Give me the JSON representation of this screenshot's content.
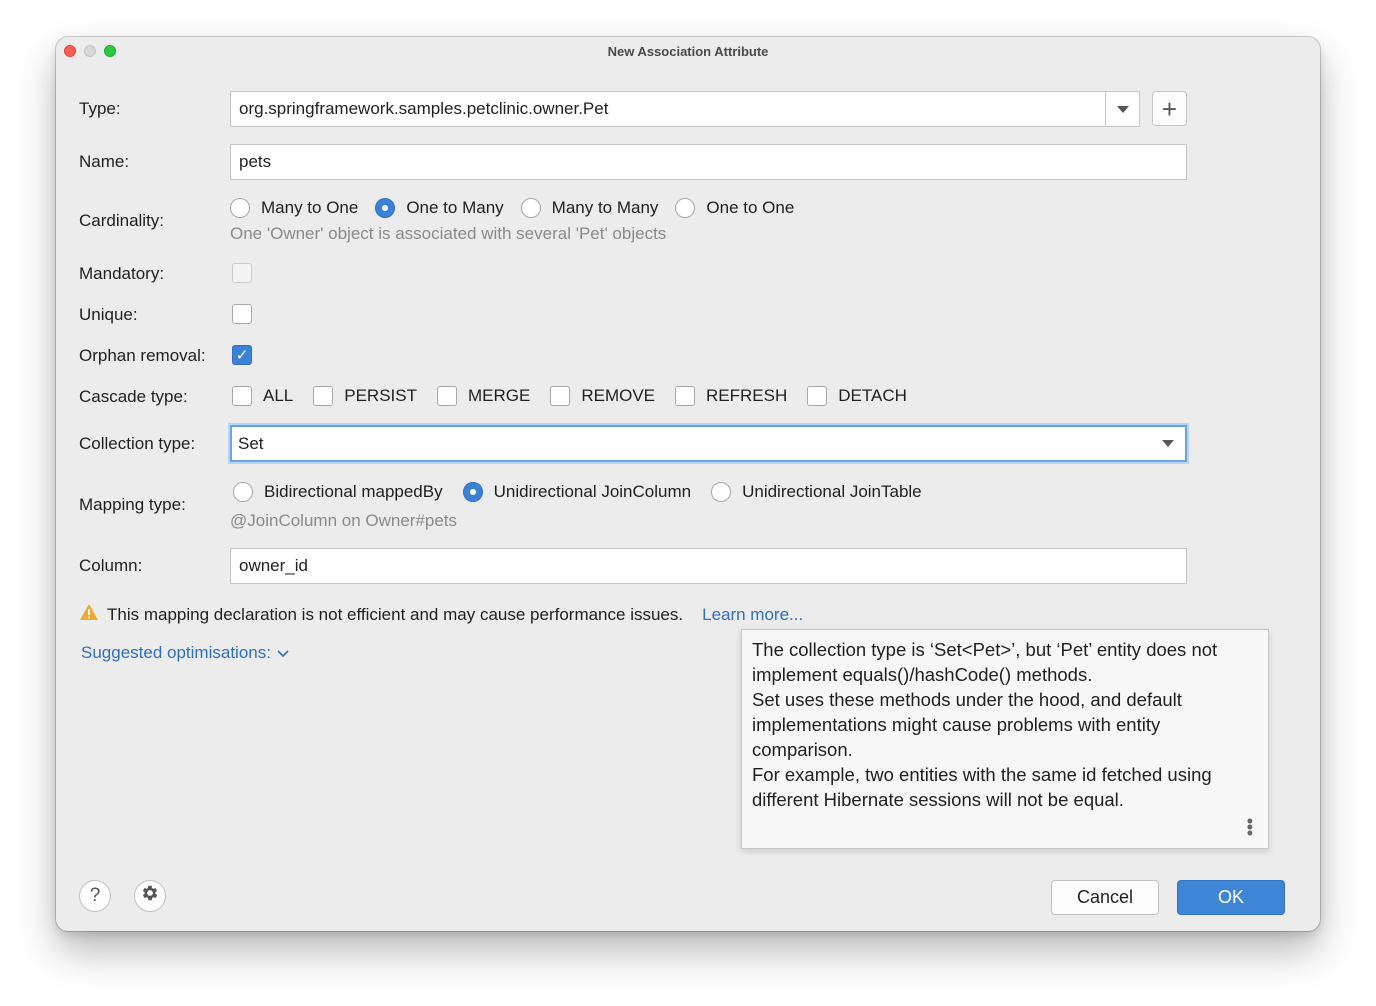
{
  "window": {
    "title": "New Association Attribute"
  },
  "type": {
    "label": "Type:",
    "value": "org.springframework.samples.petclinic.owner.Pet",
    "add_button": "+"
  },
  "name": {
    "label": "Name:",
    "value": "pets"
  },
  "cardinality": {
    "label": "Cardinality:",
    "options": [
      "Many to One",
      "One to Many",
      "Many to Many",
      "One to One"
    ],
    "selected": "One to Many",
    "hint": "One 'Owner' object is associated with several 'Pet' objects"
  },
  "mandatory": {
    "label": "Mandatory:",
    "checked": false,
    "enabled": false
  },
  "unique": {
    "label": "Unique:",
    "checked": false
  },
  "orphan_removal": {
    "label": "Orphan removal:",
    "checked": true
  },
  "cascade": {
    "label": "Cascade type:",
    "options": [
      "ALL",
      "PERSIST",
      "MERGE",
      "REMOVE",
      "REFRESH",
      "DETACH"
    ]
  },
  "collection_type": {
    "label": "Collection type:",
    "value": "Set"
  },
  "mapping_type": {
    "label": "Mapping type:",
    "options": [
      "Bidirectional mappedBy",
      "Unidirectional JoinColumn",
      "Unidirectional JoinTable"
    ],
    "selected": "Unidirectional JoinColumn",
    "hint": "@JoinColumn on Owner#pets"
  },
  "column": {
    "label": "Column:",
    "value": "owner_id"
  },
  "warning": {
    "text": "This mapping declaration is not efficient and may cause performance issues.",
    "link": "Learn more..."
  },
  "suggested": {
    "label": "Suggested optimisations:"
  },
  "tooltip": {
    "paragraphs": [
      "The collection type is ‘Set<Pet>’, but ‘Pet’ entity does not implement equals()/hashCode() methods.",
      "Set uses these methods under the hood, and default implementations might cause problems with entity comparison.",
      "For example, two entities with the same id fetched using different Hibernate sessions will not be equal."
    ]
  },
  "footer": {
    "help": "?",
    "cancel": "Cancel",
    "ok": "OK"
  },
  "colors": {
    "accent": "#3e86d5",
    "link": "#2e6fbe",
    "warning": "#f0a830"
  }
}
